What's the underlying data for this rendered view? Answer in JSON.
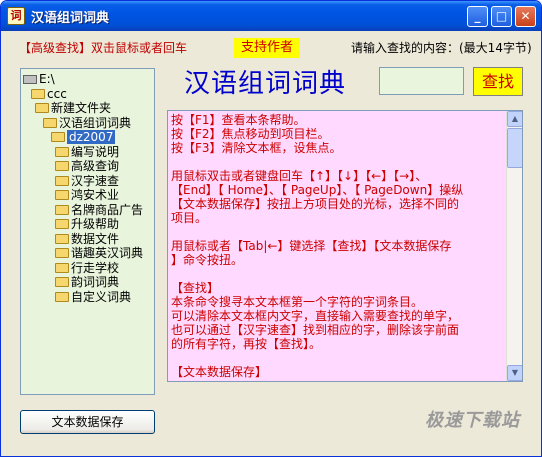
{
  "window": {
    "title": "汉语组词词典",
    "icon_glyph": "词",
    "controls": {
      "minimize": "_",
      "maximize": "□",
      "close": "✕"
    }
  },
  "header": {
    "advanced_search": "【高级查找】双击鼠标或者回车",
    "support_author": "支持作者",
    "search_hint": "请输入查找的内容：(最大14字节)"
  },
  "main": {
    "big_title": "汉语组词词典",
    "search_input_value": "",
    "search_button": "查找"
  },
  "tree": {
    "items": [
      {
        "label": "E:\\",
        "icon": "drive-icon"
      },
      {
        "label": "ccc",
        "icon": "folder-icon"
      },
      {
        "label": "新建文件夹",
        "icon": "folder-icon"
      },
      {
        "label": "汉语组词词典",
        "icon": "folder-icon"
      },
      {
        "label": "dz2007",
        "icon": "folder-open-icon",
        "selected": true
      },
      {
        "label": "编写说明",
        "icon": "folder-icon"
      },
      {
        "label": "高级查询",
        "icon": "folder-icon"
      },
      {
        "label": "汉字速查",
        "icon": "folder-icon"
      },
      {
        "label": "鸿安术业",
        "icon": "folder-icon"
      },
      {
        "label": "名牌商品广告",
        "icon": "folder-icon"
      },
      {
        "label": "升级帮助",
        "icon": "folder-icon"
      },
      {
        "label": "数据文件",
        "icon": "folder-icon"
      },
      {
        "label": "谐趣英汉词典",
        "icon": "folder-icon"
      },
      {
        "label": "行走学校",
        "icon": "folder-icon"
      },
      {
        "label": "韵词词典",
        "icon": "folder-icon"
      },
      {
        "label": "自定义词典",
        "icon": "folder-icon"
      }
    ]
  },
  "help": {
    "lines": [
      "按【F1】查看本条帮助。",
      "按【F2】焦点移动到项目栏。",
      "按【F3】清除文本框，设焦点。",
      "",
      "用鼠标双击或者键盘回车【↑】【↓】【←】【→】、",
      "【End】【 Home】、【 PageUp】、【 PageDown】操纵",
      "【文本数据保存】按扭上方项目处的光标，选择不同的",
      "项目。",
      "",
      "用鼠标或者【Tab|←】键选择【查找】【文本数据保存",
      "】命令按扭。",
      "",
      "【查找】",
      "本条命令搜寻本文本框第一个字符的字词条目。",
      "可以清除本文本框内文字，直接输入需要查找的单字，",
      "也可以通过【汉字速查】找到相应的字，删除该字前面",
      "的所有字符，再按【查找】。",
      "",
      "【文本数据保存】"
    ]
  },
  "footer": {
    "save_button": "文本数据保存",
    "watermark": "极速下载站"
  },
  "colors": {
    "titlebar": "#0054e3",
    "window_bg": "#ece9d8",
    "help_bg": "#ffd9ff",
    "help_text": "#cc0000",
    "tree_bg": "#e8f4dc",
    "search_button_bg": "#ffff00",
    "big_title": "#0000cc"
  }
}
